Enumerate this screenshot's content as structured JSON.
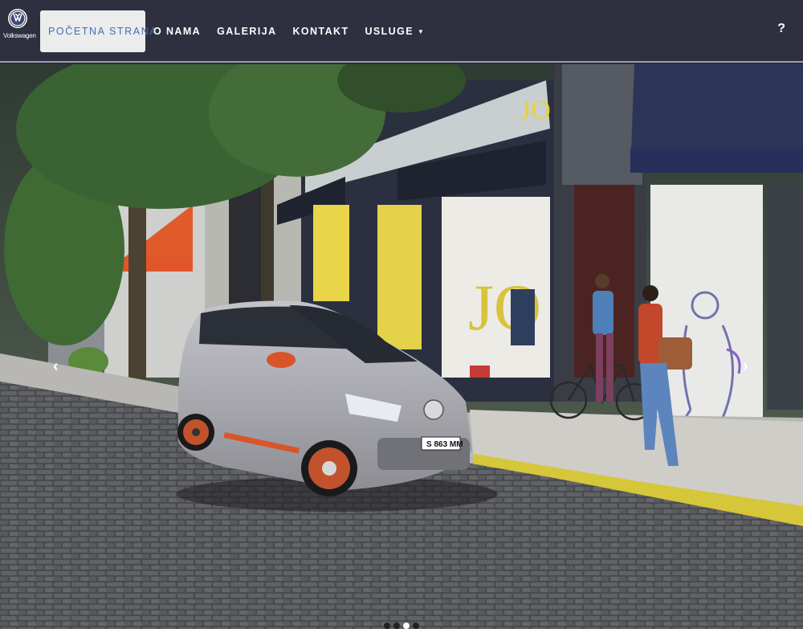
{
  "brand": {
    "name": "Volkswagen",
    "logo_icon": "vw-logo-icon"
  },
  "nav": {
    "items": [
      {
        "label": "POČETNA STRANA",
        "active": true
      },
      {
        "label": "O NAMA"
      },
      {
        "label": "GALERIJA"
      },
      {
        "label": "KONTAKT"
      },
      {
        "label": "USLUGE",
        "dropdown": true
      }
    ],
    "help_label": "?"
  },
  "hero": {
    "store_sign": "JO",
    "window_text": "JO",
    "license_plate": "S 863 MM",
    "slides_count": 3,
    "active_slide": 2,
    "prev_icon": "chevron-left-icon",
    "next_icon": "chevron-right-icon"
  },
  "colors": {
    "nav_bg": "#2e3040",
    "active_bg": "#ececec",
    "active_text": "#3d6fb3",
    "car_body": "#a7a8ad",
    "car_accent": "#d9542a",
    "sign_yellow": "#e6d23a"
  }
}
